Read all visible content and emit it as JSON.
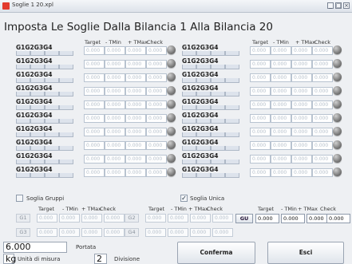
{
  "window": {
    "title": "Soglie 1 20.xpl",
    "buttons": [
      "minimize",
      "maximize",
      "close"
    ]
  },
  "heading": "Imposta Le Soglie Dalla Bilancia 1 Alla Bilancia 20",
  "columns": {
    "target": "Target",
    "tmin": "- TMin",
    "tmax": "+ TMax",
    "check": "Check"
  },
  "rows": {
    "group_label": "G1G2G3G4",
    "field_value": "0.000",
    "count_per_column": 10
  },
  "soglia_gruppi": {
    "label": "Soglia Gruppi",
    "checked": false
  },
  "soglia_unica": {
    "label": "Soglia Unica",
    "checked": true
  },
  "groups": [
    {
      "label": "G1"
    },
    {
      "label": "G2"
    },
    {
      "label": "G3"
    },
    {
      "label": "G4"
    }
  ],
  "group_field_value": "0.000",
  "gu": {
    "label": "GU",
    "target": "0.000",
    "tmin": "0.000",
    "tmax": "0.000",
    "check": "0.000"
  },
  "portata": {
    "value": "6.000",
    "label": "Portata"
  },
  "unit": {
    "value": "kg",
    "label": "Unità di misura"
  },
  "divisione": {
    "value": "2",
    "label": "Divisione"
  },
  "conferma_label": "Conferma",
  "esci_label": "Esci"
}
